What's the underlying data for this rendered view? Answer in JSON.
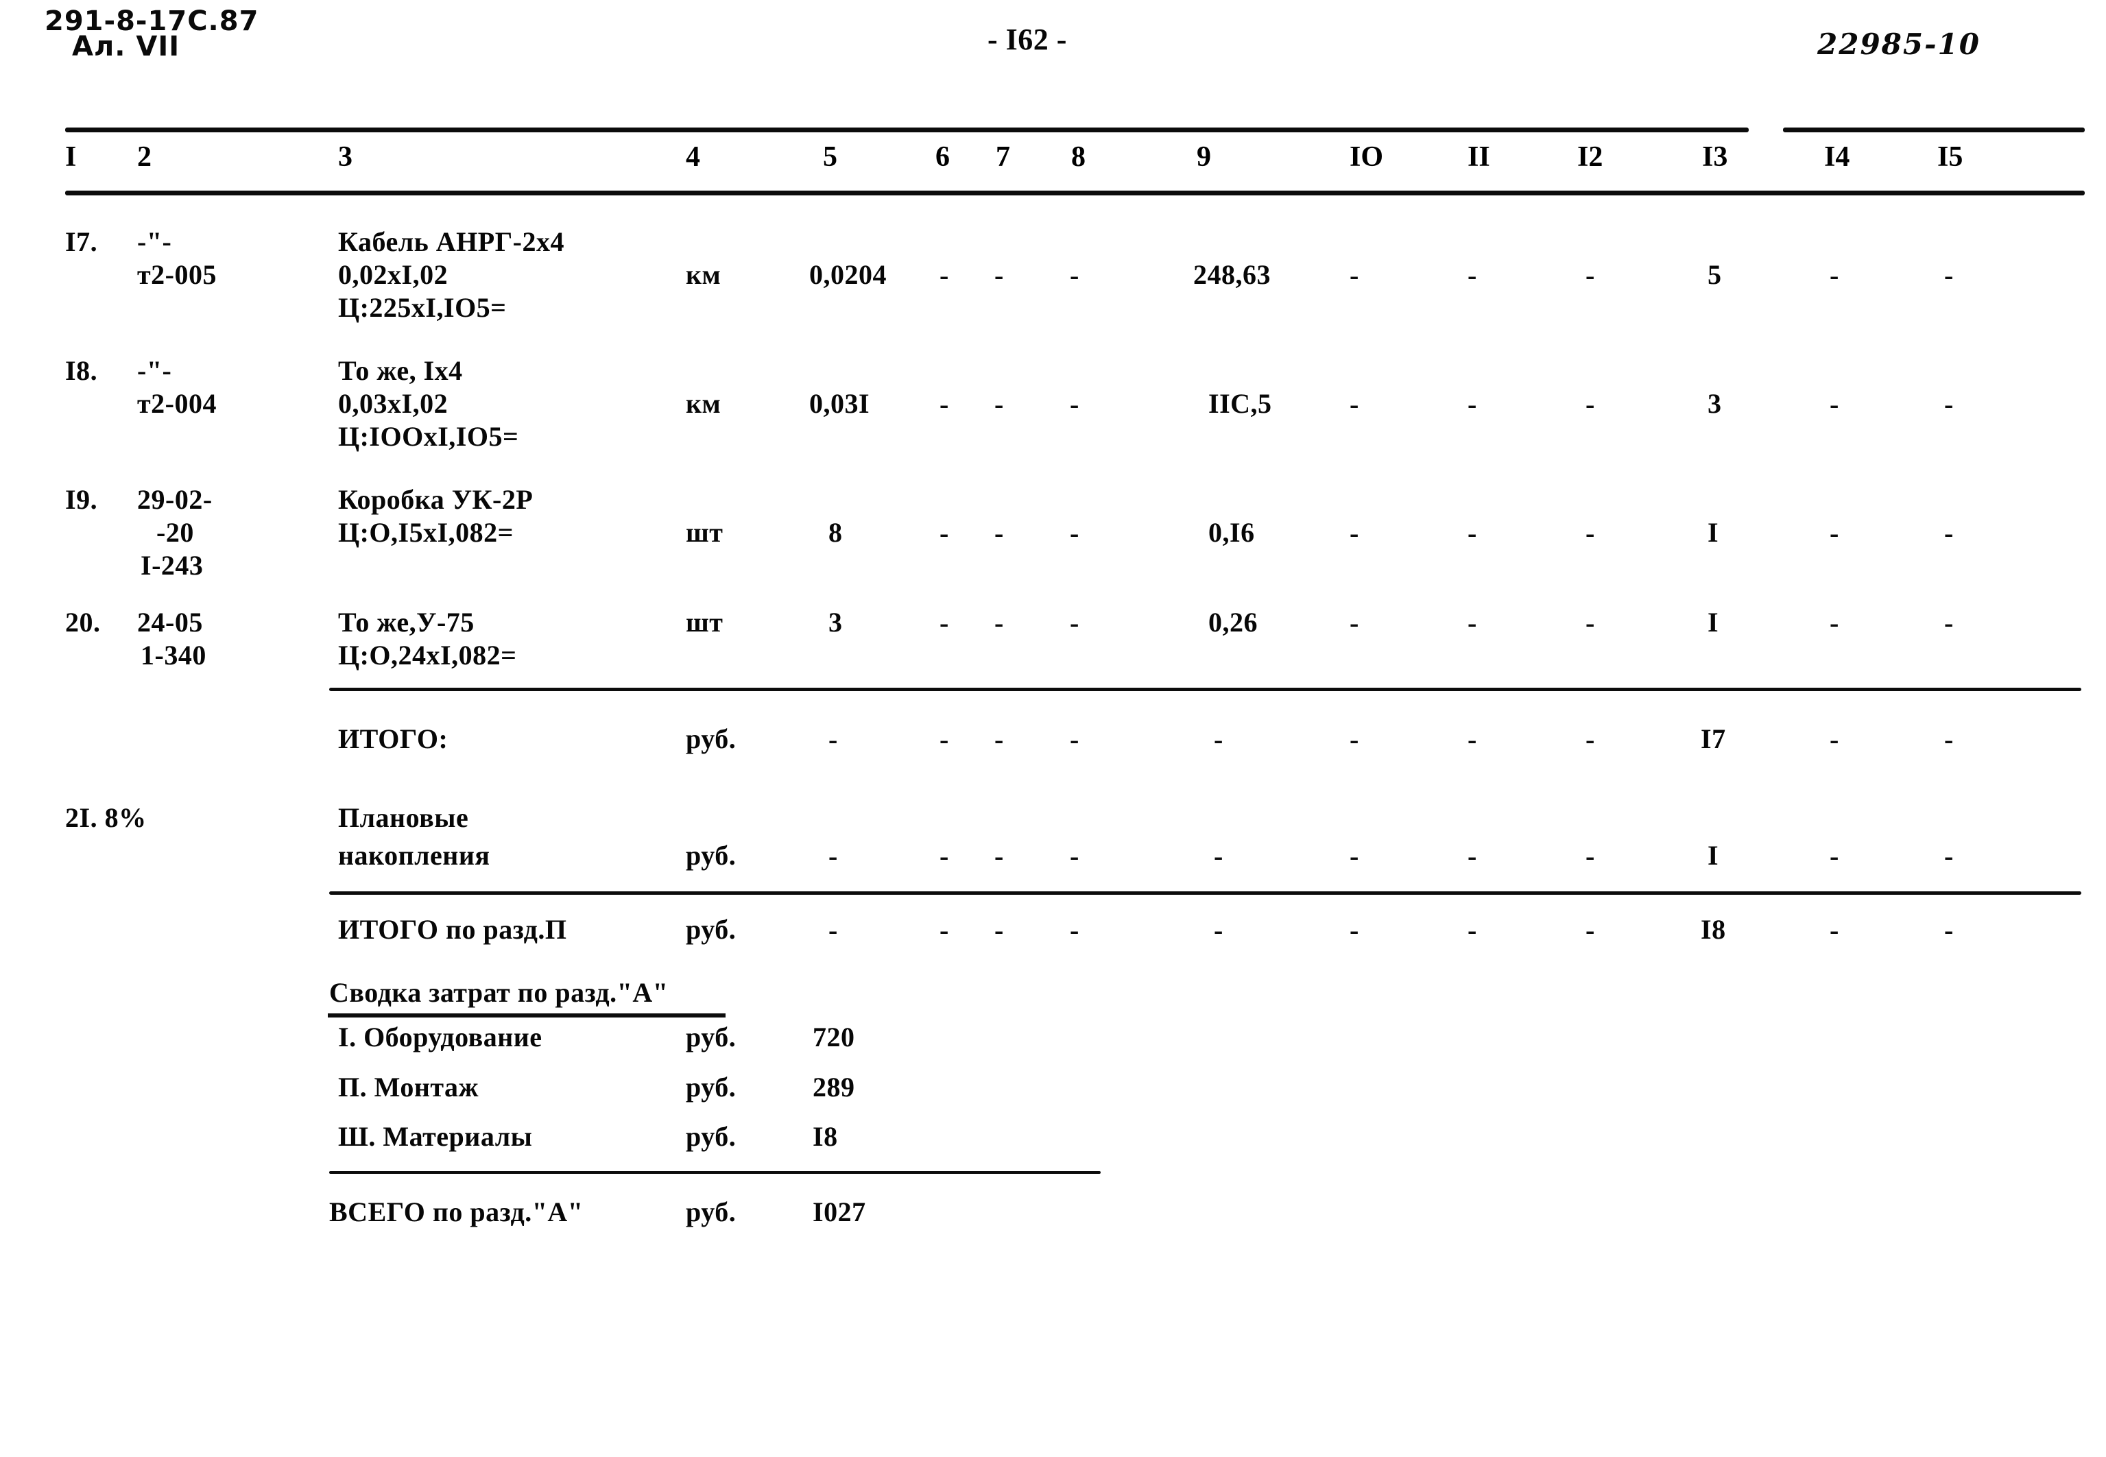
{
  "document": {
    "stamp_top_left_line1": "291-8-17С.87",
    "stamp_top_left_line2": "Ал. VII",
    "page_number": "- I62 -",
    "stamp_top_right": "22985-10"
  },
  "table": {
    "column_headers": [
      "I",
      "2",
      "3",
      "4",
      "5",
      "6",
      "7",
      "8",
      "9",
      "IO",
      "II",
      "I2",
      "I3",
      "I4",
      "I5"
    ],
    "dash": "-",
    "rows": [
      {
        "no": "I7.",
        "code_lines": [
          "-\"-",
          "т2-005"
        ],
        "name_lines": [
          "Кабель АНРГ-2х4",
          "0,02хI,02",
          "Ц:225хI,IO5="
        ],
        "unit": "км",
        "c5": "0,0204",
        "c6": "-",
        "c7": "-",
        "c8": "-",
        "c9": "248,63",
        "c10": "-",
        "c11": "-",
        "c12": "-",
        "c13": "5",
        "c14": "-",
        "c15": "-"
      },
      {
        "no": "I8.",
        "code_lines": [
          "-\"-",
          "т2-004"
        ],
        "name_lines": [
          "То же, Iх4",
          "0,03хI,02",
          "Ц:IOOхI,IO5="
        ],
        "unit": "км",
        "c5": "0,03I",
        "c6": "-",
        "c7": "-",
        "c8": "-",
        "c9": "IIC,5",
        "c10": "-",
        "c11": "-",
        "c12": "-",
        "c13": "3",
        "c14": "-",
        "c15": "-"
      },
      {
        "no": "I9.",
        "code_lines": [
          "29-02-",
          "-20",
          "I-243"
        ],
        "name_lines": [
          "Коробка УК-2Р",
          "Ц:О,I5хI,082="
        ],
        "unit": "шт",
        "c5": "8",
        "c6": "-",
        "c7": "-",
        "c8": "-",
        "c9": "0,I6",
        "c10": "-",
        "c11": "-",
        "c12": "-",
        "c13": "I",
        "c14": "-",
        "c15": "-"
      },
      {
        "no": "20.",
        "code_lines": [
          "24-05",
          "1-340"
        ],
        "name_lines": [
          "То же,У-75",
          "Ц:О,24хI,082="
        ],
        "unit": "шт",
        "c5": "3",
        "c6": "-",
        "c7": "-",
        "c8": "-",
        "c9": "0,26",
        "c10": "-",
        "c11": "-",
        "c12": "-",
        "c13": "I",
        "c14": "-",
        "c15": "-"
      }
    ],
    "totals": [
      {
        "no": "",
        "label_lines": [
          "ИТОГО:"
        ],
        "unit": "руб.",
        "c5": "-",
        "c6": "-",
        "c7": "-",
        "c8": "-",
        "c9": "-",
        "c10": "-",
        "c11": "-",
        "c12": "-",
        "c13": "I7",
        "c14": "-",
        "c15": "-"
      },
      {
        "no": "2I. 8%",
        "label_lines": [
          "Плановые",
          "накопления"
        ],
        "unit": "руб.",
        "c5": "-",
        "c6": "-",
        "c7": "-",
        "c8": "-",
        "c9": "-",
        "c10": "-",
        "c11": "-",
        "c12": "-",
        "c13": "I",
        "c14": "-",
        "c15": "-"
      },
      {
        "no": "",
        "label_lines": [
          "ИТОГО по разд.П"
        ],
        "unit": "руб.",
        "c5": "-",
        "c6": "-",
        "c7": "-",
        "c8": "-",
        "c9": "-",
        "c10": "-",
        "c11": "-",
        "c12": "-",
        "c13": "I8",
        "c14": "-",
        "c15": "-"
      }
    ]
  },
  "summary": {
    "title": "Сводка затрат по разд.\"А\"",
    "lines": [
      {
        "label": "I. Оборудование",
        "unit": "руб.",
        "value": "720"
      },
      {
        "label": "П. Монтаж",
        "unit": "руб.",
        "value": "289"
      },
      {
        "label": "Ш. Материалы",
        "unit": "руб.",
        "value": "I8"
      }
    ],
    "grand_total": {
      "label": "ВСЕГО по разд.\"А\"",
      "unit": "руб.",
      "value": "I027"
    }
  }
}
